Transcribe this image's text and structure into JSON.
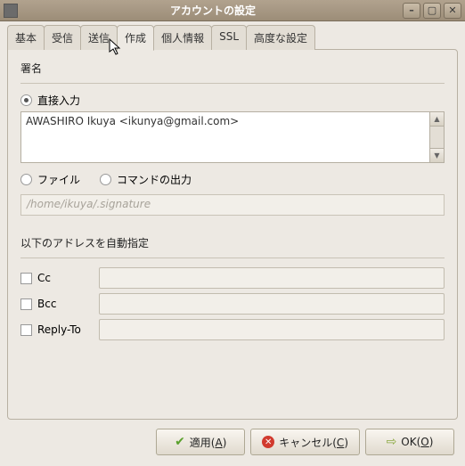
{
  "window": {
    "title": "アカウントの設定"
  },
  "tabs": {
    "items": [
      {
        "label": "基本"
      },
      {
        "label": "受信"
      },
      {
        "label": "送信"
      },
      {
        "label": "作成"
      },
      {
        "label": "個人情報"
      },
      {
        "label": "SSL"
      },
      {
        "label": "高度な設定"
      }
    ],
    "active_index": 3
  },
  "signature": {
    "title": "署名",
    "direct_label": "直接入力",
    "text": "AWASHIRO Ikuya <ikunya@gmail.com>",
    "file_label": "ファイル",
    "command_label": "コマンドの出力",
    "path_placeholder": "/home/ikuya/.signature"
  },
  "auto": {
    "title": "以下のアドレスを自動指定",
    "cc_label": "Cc",
    "bcc_label": "Bcc",
    "replyto_label": "Reply-To"
  },
  "buttons": {
    "apply": "適用(A)",
    "cancel": "キャンセル(C)",
    "ok": "OK(O)"
  }
}
